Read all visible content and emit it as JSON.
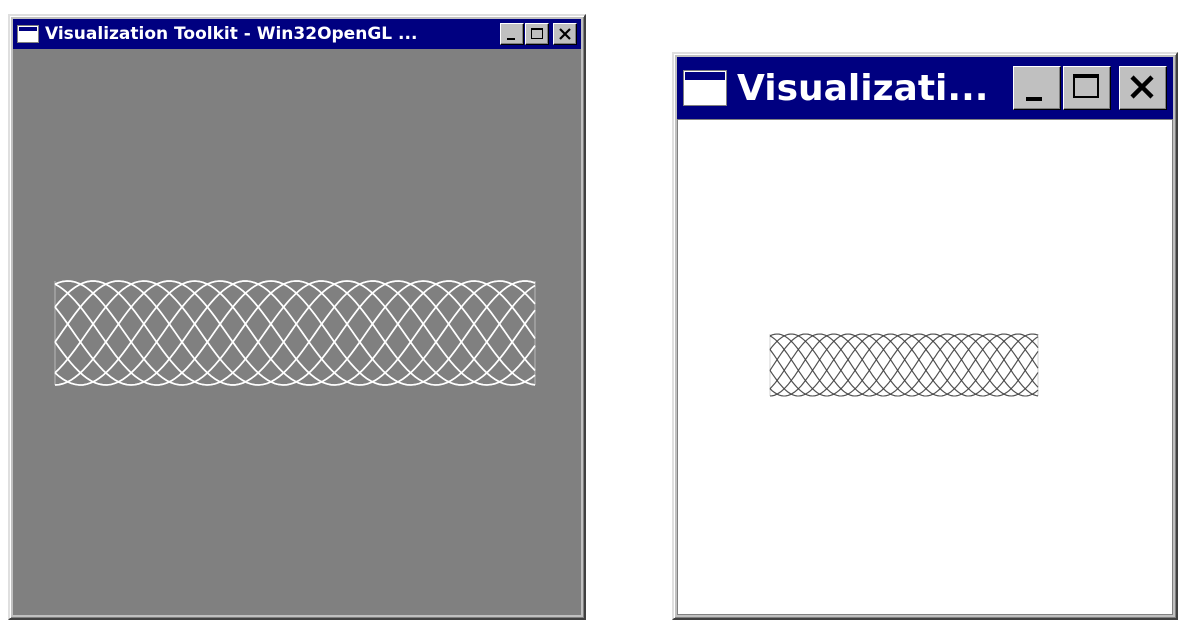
{
  "left_window": {
    "title": "Visualization Toolkit - Win32OpenGL ...",
    "background_color": "#808080",
    "mesh_color": "#ffffff"
  },
  "right_window": {
    "title": "Visualizati...",
    "background_color": "#ffffff",
    "mesh_color": "#404040"
  },
  "controls": {
    "minimize_icon": "minimize-icon",
    "maximize_icon": "maximize-icon",
    "close_icon": "close-icon"
  },
  "colors": {
    "titlebar": "#000080",
    "chrome": "#c0c0c0"
  }
}
